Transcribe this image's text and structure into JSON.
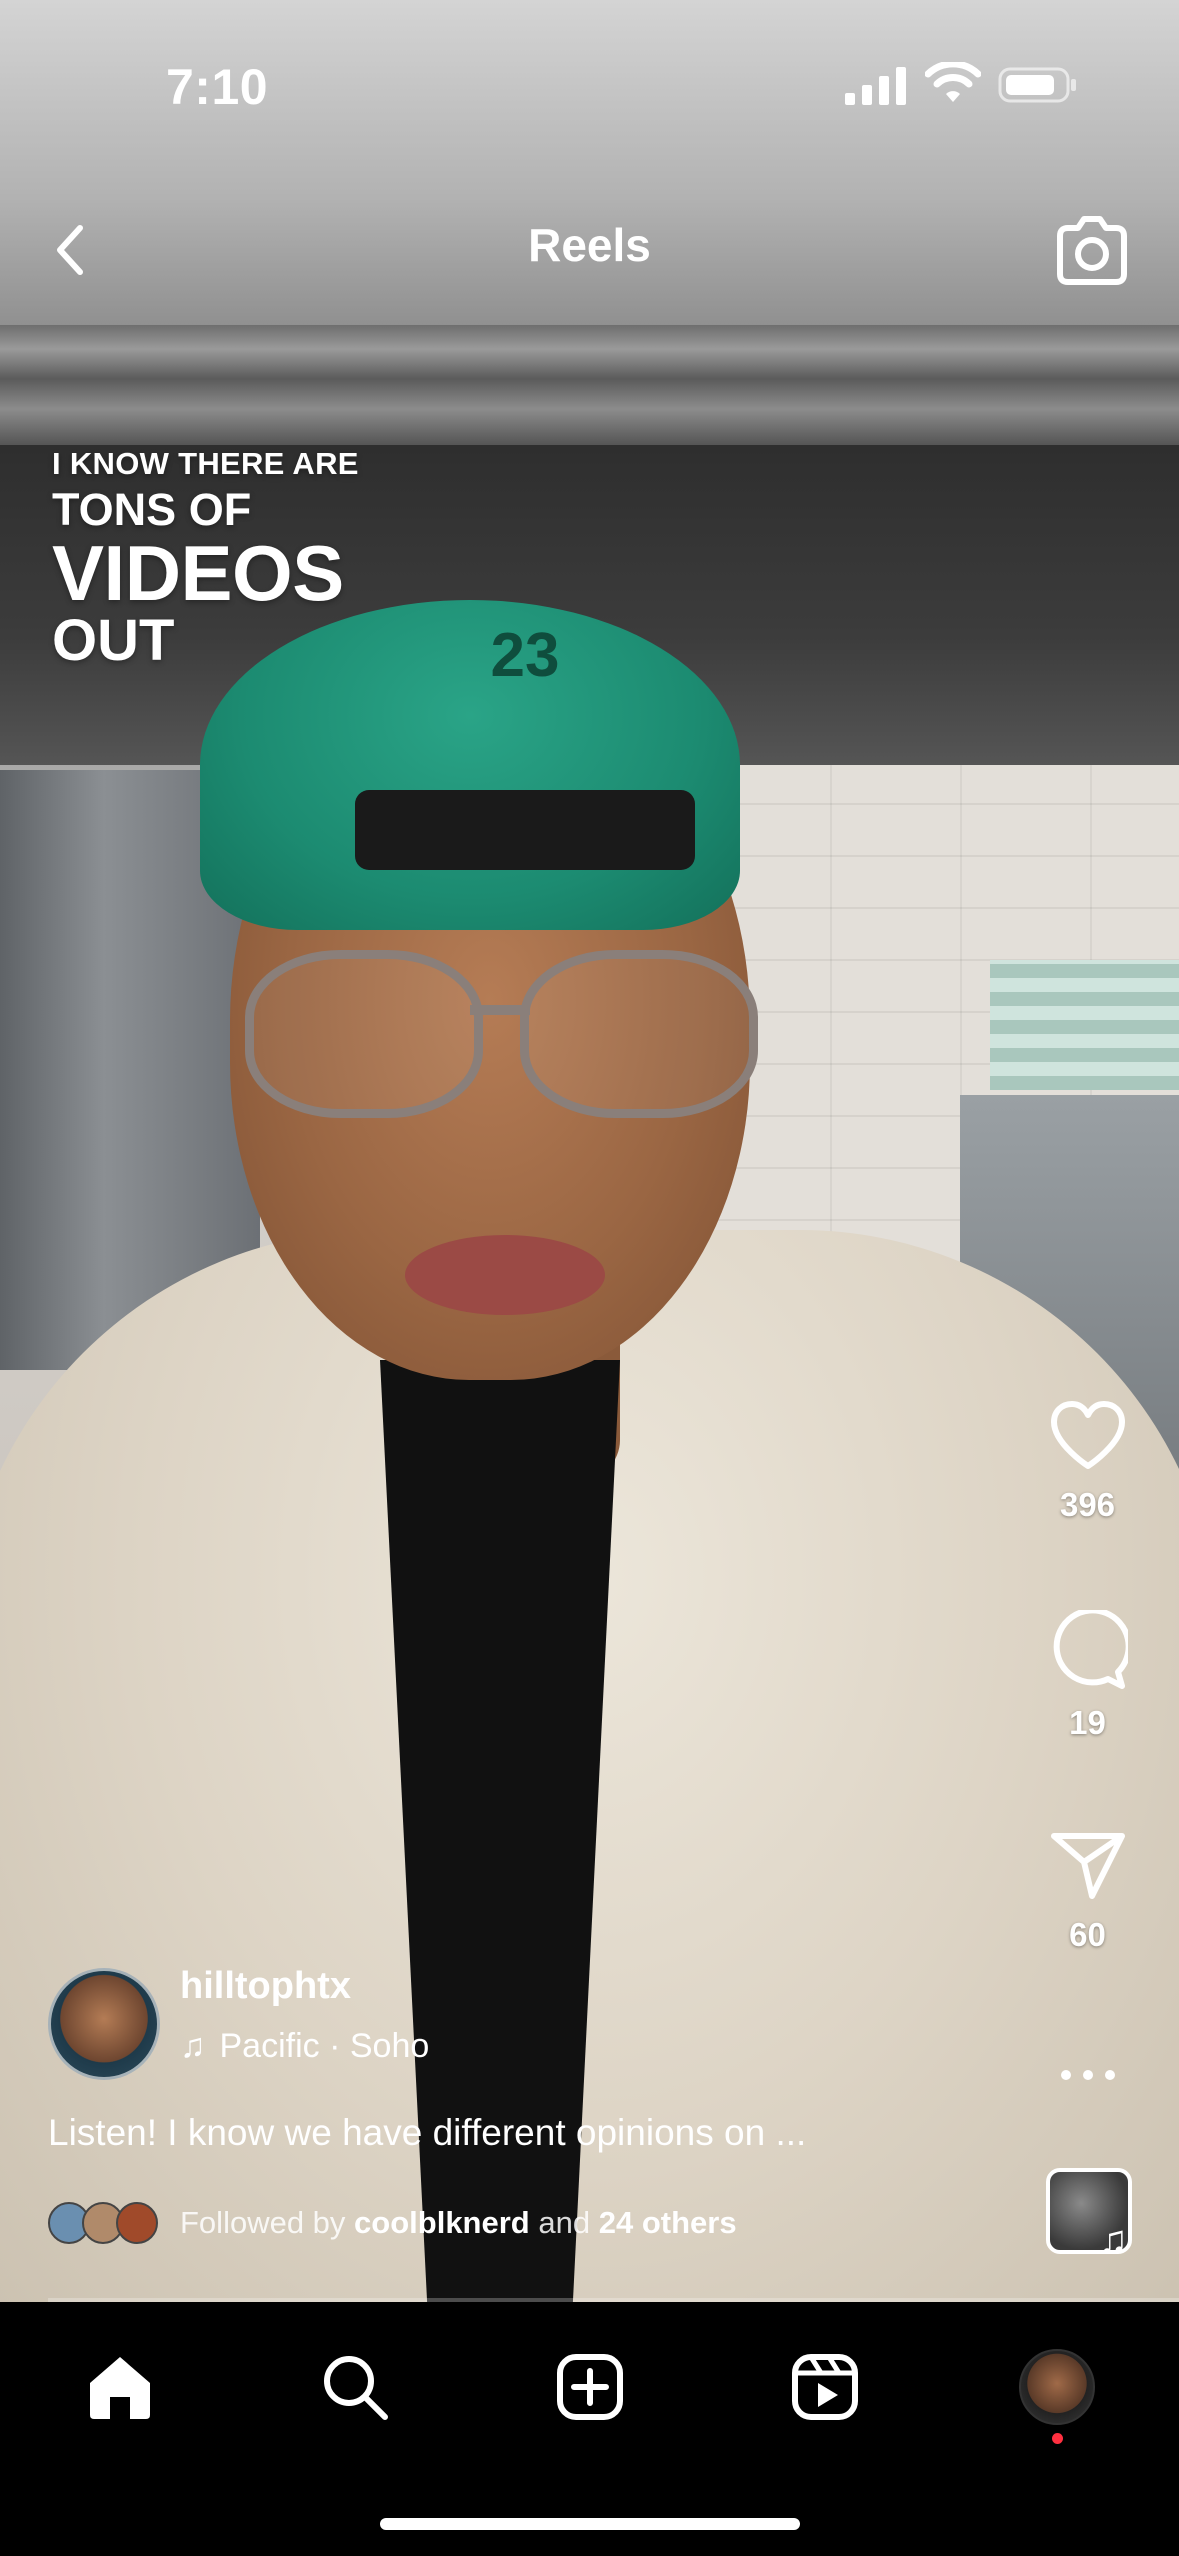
{
  "status_bar": {
    "time": "7:10"
  },
  "header": {
    "title": "Reels"
  },
  "video": {
    "overlay_text": [
      "I KNOW THERE ARE",
      "TONS OF",
      "VIDEOS",
      "OUT"
    ],
    "cap_number": "23",
    "progress_fraction": 0.0
  },
  "actions": {
    "like_count": "396",
    "comment_count": "19",
    "share_count": "60"
  },
  "author": {
    "username": "hilltophtx",
    "audio": "Pacific · Soho"
  },
  "caption": "Listen! I know we have different opinions on ...",
  "followed_by": {
    "prefix": "Followed by",
    "user": "coolblknerd",
    "joiner": "and",
    "others": "24 others"
  },
  "tabs": [
    "home-icon",
    "search-icon",
    "create-icon",
    "reels-icon",
    "profile-avatar"
  ],
  "colors": {
    "notification_dot": "#ff3040",
    "background": "#000000"
  }
}
